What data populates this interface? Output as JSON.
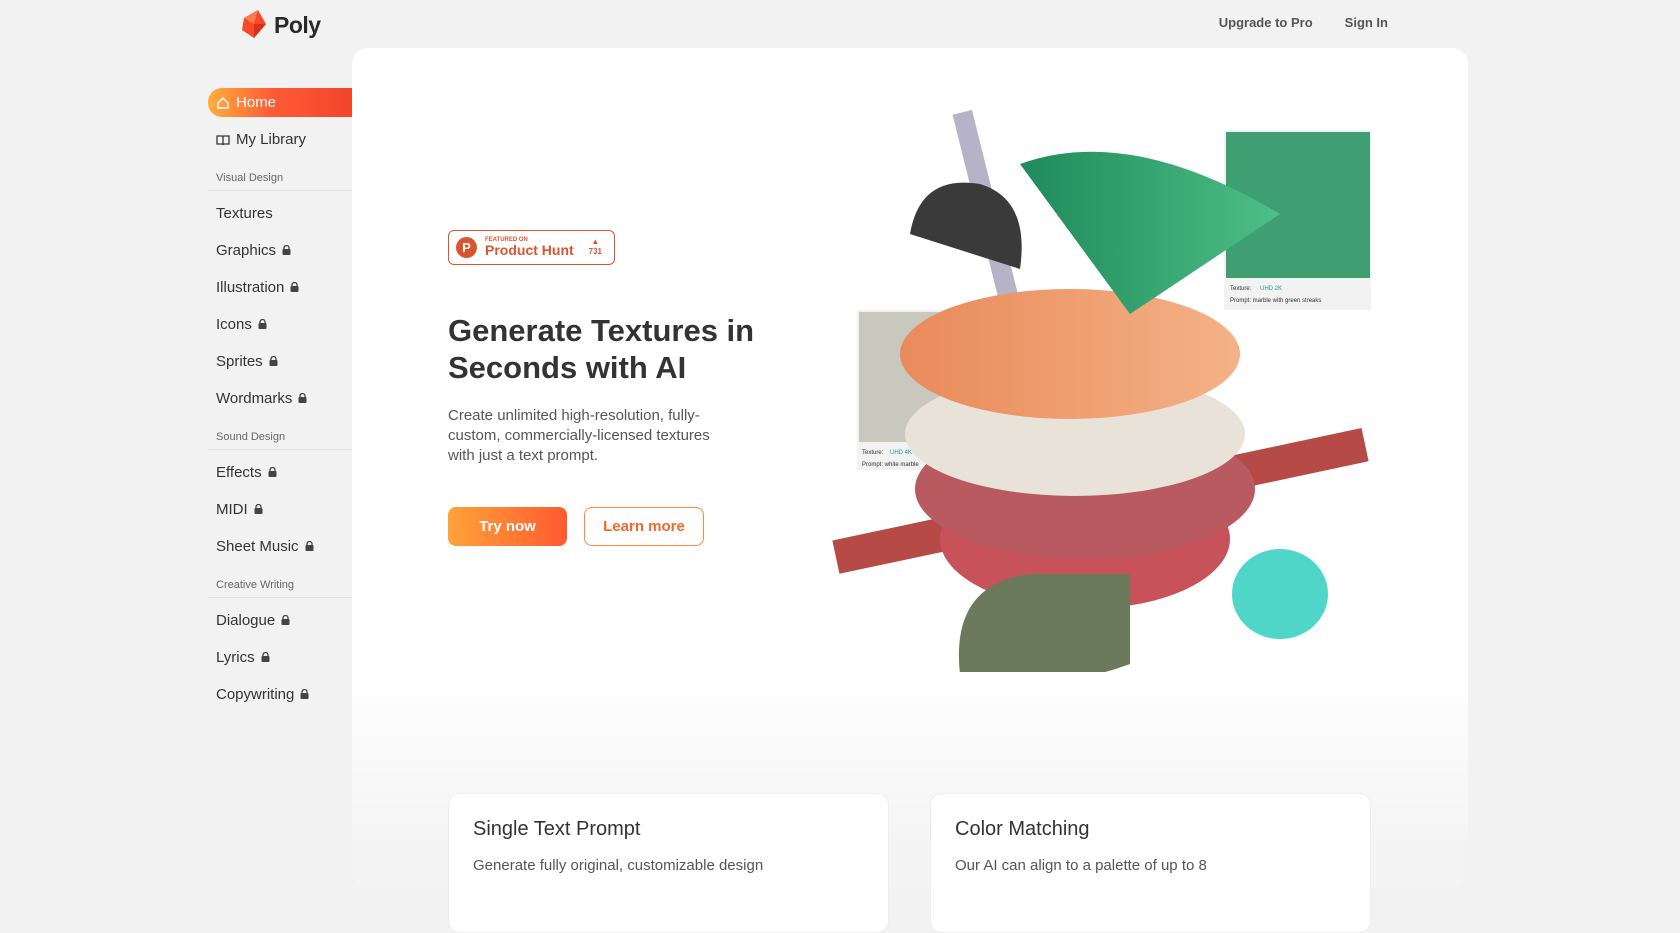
{
  "brand": {
    "name": "Poly"
  },
  "topnav": {
    "upgrade": "Upgrade to Pro",
    "signin": "Sign In"
  },
  "sidebar": {
    "main": [
      {
        "label": "Home",
        "icon": "home-icon",
        "active": true
      },
      {
        "label": "My Library",
        "icon": "book-icon"
      }
    ],
    "sections": [
      {
        "title": "Visual Design",
        "items": [
          {
            "label": "Textures",
            "locked": false
          },
          {
            "label": "Graphics",
            "locked": true
          },
          {
            "label": "Illustration",
            "locked": true
          },
          {
            "label": "Icons",
            "locked": true
          },
          {
            "label": "Sprites",
            "locked": true
          },
          {
            "label": "Wordmarks",
            "locked": true
          }
        ]
      },
      {
        "title": "Sound Design",
        "items": [
          {
            "label": "Effects",
            "locked": true
          },
          {
            "label": "MIDI",
            "locked": true
          },
          {
            "label": "Sheet Music",
            "locked": true
          }
        ]
      },
      {
        "title": "Creative Writing",
        "items": [
          {
            "label": "Dialogue",
            "locked": true
          },
          {
            "label": "Lyrics",
            "locked": true
          },
          {
            "label": "Copywriting",
            "locked": true
          }
        ]
      }
    ]
  },
  "hero": {
    "badge": {
      "small": "FEATURED ON",
      "name": "Product Hunt",
      "votes": "731",
      "letter": "P"
    },
    "title": "Generate Textures in Seconds with AI",
    "description": "Create unlimited high-resolution, fully-custom, commercially-licensed textures with just a text prompt.",
    "try_label": "Try now",
    "learn_label": "Learn more",
    "art": {
      "tag1_texture": "Texture:",
      "tag1_res": "UHD 2K",
      "tag1_prompt": "Prompt: marble with green streaks",
      "tag2_texture": "Texture:",
      "tag2_res": "UHD 4K",
      "tag2_prompt": "Prompt: white marble"
    }
  },
  "features": [
    {
      "title": "Single Text Prompt",
      "text": "Generate fully original, customizable design"
    },
    {
      "title": "Color Matching",
      "text": "Our AI can align to a palette of up to 8"
    }
  ],
  "colors": {
    "accent": "#ff5a36",
    "producthunt": "#da552f"
  }
}
